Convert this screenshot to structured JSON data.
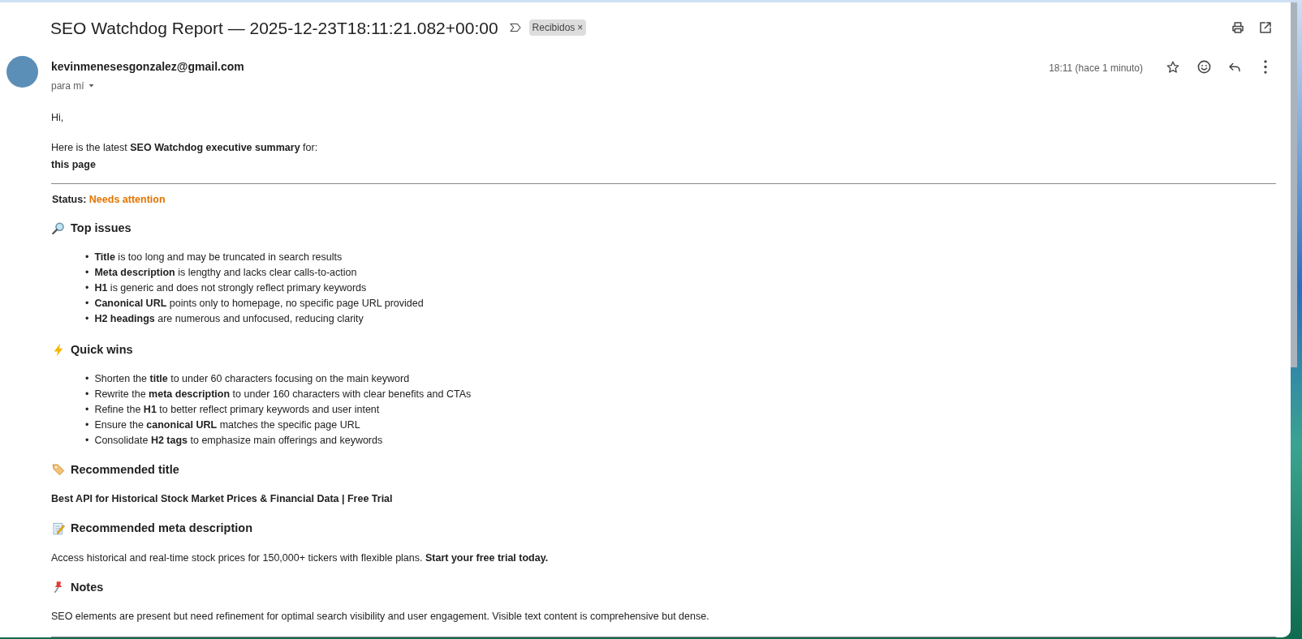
{
  "subject": "SEO Watchdog Report — 2025-12-23T18:11:21.082+00:00",
  "label": {
    "text": "Recibidos",
    "remove": "×"
  },
  "sender": {
    "email": "kevinmenesesgonzalez@gmail.com",
    "recipient": "para mí",
    "time": "18:11 (hace 1 minuto)",
    "starred": false
  },
  "greeting": "Hi,",
  "intro": "Here is the latest **SEO Watchdog executive summary** for:",
  "page": "this page",
  "status": {
    "label": "Status:",
    "value": "Needs attention"
  },
  "sections": [
    {
      "kind": "issues",
      "heading": "Top issues",
      "bullet": "•",
      "items": [
        "**Title** is too long and may be truncated in search results",
        "**Meta description** is lengthy and lacks clear calls-to-action",
        "**H1** is generic and does not strongly reflect primary keywords",
        "**Canonical URL** points only to homepage, no specific page URL provided",
        "**H2 headings** are numerous and unfocused, reducing clarity"
      ]
    },
    {
      "kind": "wins",
      "heading": "Quick wins",
      "bullet": "•",
      "items": [
        "Shorten the **title** to under 60 characters focusing on the main keyword",
        "Rewrite the **meta description** to under 160 characters with clear benefits and CTAs",
        "Refine the **H1** to better reflect primary keywords and user intent",
        "Ensure the **canonical URL** matches the specific page URL",
        "Consolidate **H2 tags** to emphasize main offerings and keywords"
      ]
    },
    {
      "kind": "title",
      "heading": "Recommended title",
      "text": "Best API for Historical Stock Market Prices & Financial Data | Free Trial"
    },
    {
      "kind": "meta",
      "heading": "Recommended meta description",
      "text": "Access historical and real-time stock prices for 150,000+ tickers with flexible plans. **Start your free trial today.**"
    },
    {
      "kind": "notes",
      "heading": "Notes",
      "text": "SEO elements are present but need refinement for optimal search visibility and user engagement. Visible text content is comprehensive but dense."
    }
  ]
}
